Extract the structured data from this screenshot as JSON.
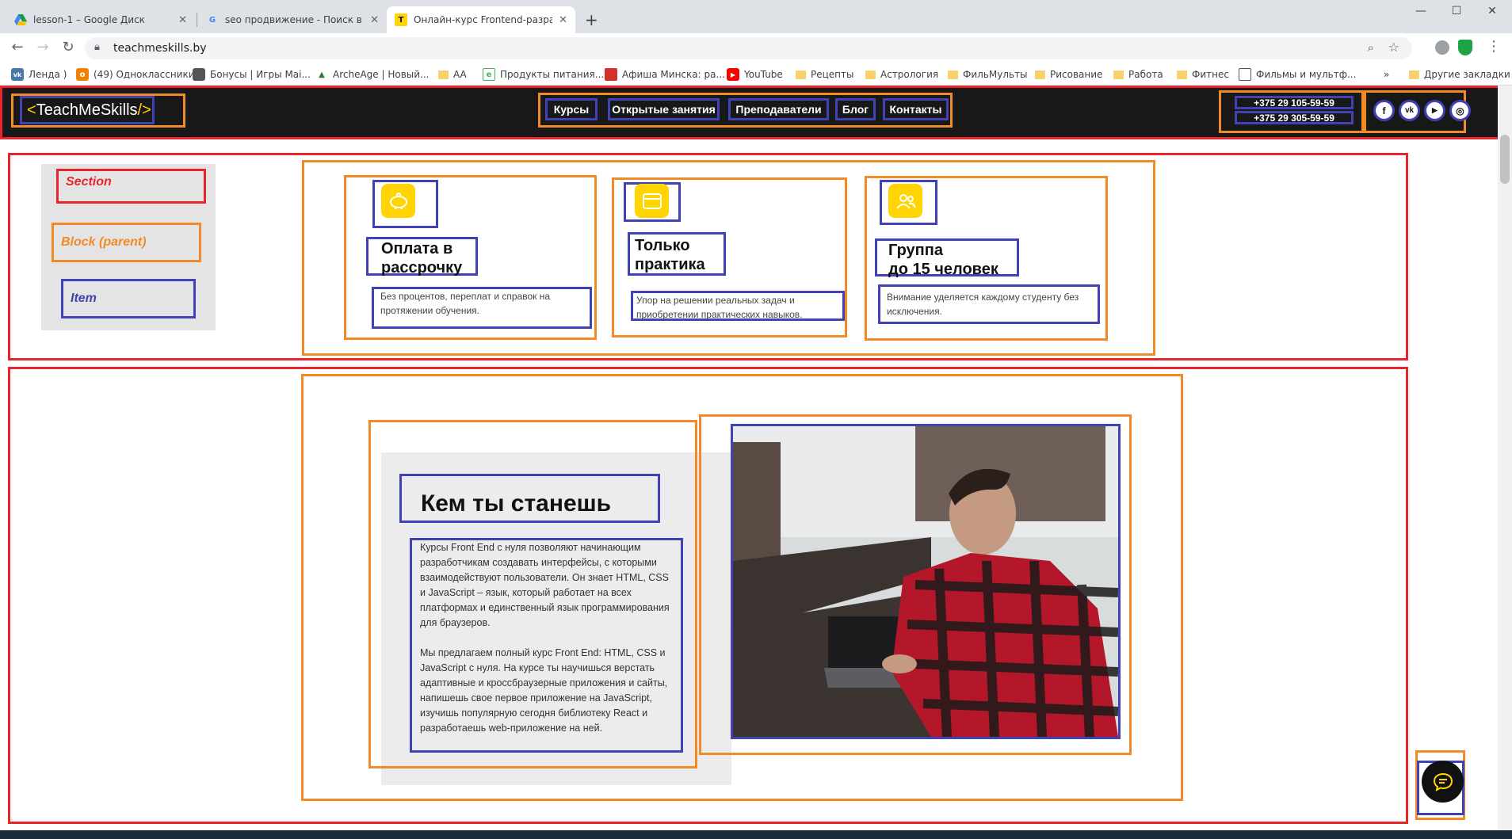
{
  "browser": {
    "tabs": [
      {
        "title": "lesson-1 – Google Диск",
        "active": false
      },
      {
        "title": "seo продвижение - Поиск в Goo",
        "active": false
      },
      {
        "title": "Онлайн-курс Frontend-разрабо",
        "active": true
      }
    ],
    "new_tab": "+",
    "url": "teachmeskills.by",
    "bookmarks": [
      "Ленда )",
      "(49) Одноклассники",
      "Бонусы | Игры Mai...",
      "ArcheAge | Новый...",
      "AA",
      "Продукты питания...",
      "Афиша Минска: ра...",
      "YouTube",
      "Рецепты",
      "Астрология",
      "ФильМульты",
      "Рисование",
      "Работа",
      "Фитнес",
      "Фильмы и мультф...",
      "»",
      "Другие закладки"
    ]
  },
  "header": {
    "logo": {
      "left": "<",
      "text": "TeachMeSkills",
      "right": "/>"
    },
    "nav": [
      "Курсы",
      "Открытые занятия",
      "Преподаватели",
      "Блог",
      "Контакты"
    ],
    "phones": [
      "+375 29 105-59-59",
      "+375 29 305-59-59"
    ],
    "social": [
      "f",
      "vk",
      "▶",
      "◎"
    ]
  },
  "legend": {
    "section": "Section",
    "block": "Block (parent)",
    "item": "Item",
    "colors": {
      "section": "#e8252d",
      "block": "#f08b28",
      "item": "#4142b5"
    }
  },
  "features": [
    {
      "title_line1": "Оплата в",
      "title_line2": "рассрочку",
      "desc": "Без процентов, переплат и справок на протяжении обучения.",
      "icon": "piggy-bank-icon"
    },
    {
      "title_line1": "Только",
      "title_line2": "практика",
      "desc": "Упор на решении реальных задач и приобретении практических навыков.",
      "icon": "browser-window-icon"
    },
    {
      "title_line1": "Группа",
      "title_line2": "до 15 человек",
      "desc": "Внимание уделяется каждому студенту без исключения.",
      "icon": "people-group-icon"
    }
  ],
  "about": {
    "title": "Кем ты станешь",
    "para1": "Курсы Front End с нуля позволяют начинающим разработчикам создавать интерфейсы, с которыми взаимодействуют пользователи. Он знает HTML, CSS и JavaScript – язык, который работает на всех платформах и единственный язык программирования для браузеров.",
    "para2": "Мы предлагаем полный курс Front End: HTML, CSS и JavaScript с нуля. На курсе ты научишься верстать адаптивные и кроссбраузерные приложения и сайты, напишешь свое первое приложение на JavaScript, изучишь популярную сегодня библиотеку React и разработаешь web-приложение на ней."
  },
  "accent_color": "#ffd400"
}
